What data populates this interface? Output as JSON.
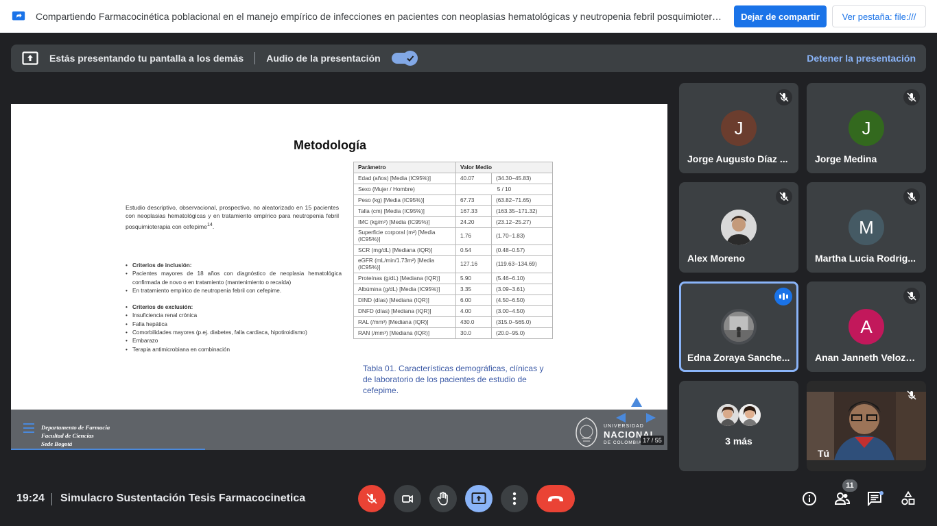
{
  "sharebar": {
    "text": "Compartiendo Farmacocinética poblacional en el manejo empírico de infecciones en pacientes con neoplasias hematológicas y neutropenia febril posquimioterapia con meet....",
    "stop_label": "Dejar de compartir",
    "view_label": "Ver pestaña: file:///"
  },
  "banner": {
    "presenting_text": "Estás presentando tu pantalla a los demás",
    "audio_label": "Audio de la presentación",
    "audio_enabled": true,
    "stop_label": "Detener la presentación"
  },
  "slide": {
    "title": "Metodología",
    "intro": "Estudio descriptivo, observacional, prospectivo, no aleatorizado en 15 pacientes con neoplasias hematológicas y en tratamiento empírico para neutropenia febril posquimioterapia con cefepime",
    "intro_ref": "14",
    "inclusion_head": "Criterios de inclusión:",
    "inclusion": [
      "Pacientes mayores de 18 años con diagnóstico de neoplasia hematológica confirmada de novo o en tratamiento (mantenimiento o recaída)",
      "En tratamiento empírico de neutropenia febril con cefepime."
    ],
    "exclusion_head": "Criterios de exclusión:",
    "exclusion": [
      "Insuficiencia renal crónica",
      "Falla hepática",
      "Comorbilidades mayores (p.ej. diabetes, falla cardiaca, hipotiroidismo)",
      "Embarazo",
      "Terapia antimicrobiana en combinación"
    ],
    "table_headers": [
      "Parámetro",
      "Valor Medio"
    ],
    "table_rows": [
      [
        "Edad (años) [Media (IC95%)]",
        "40.07",
        "(34.30−45.83)"
      ],
      [
        "Sexo (Mujer / Hombre)",
        "5 / 10",
        ""
      ],
      [
        "Peso (kg) [Media (IC95%)]",
        "67.73",
        "(63.82−71.65)"
      ],
      [
        "Talla (cm) [Media (IC95%)]",
        "167.33",
        "(163.35−171.32)"
      ],
      [
        "IMC (kg/m²) [Media (IC95%)]",
        "24.20",
        "(23.12−25.27)"
      ],
      [
        "Superficie corporal (m²) [Media (IC95%)]",
        "1.76",
        "(1.70−1.83)"
      ],
      [
        "SCR (mg/dL) [Mediana (IQR)]",
        "0.54",
        "(0.48−0.57)"
      ],
      [
        "eGFR (mL/min/1.73m²) [Media (IC95%)]",
        "127.16",
        "(119.63−134.69)"
      ],
      [
        "Proteínas (g/dL) [Mediana (IQR)]",
        "5.90",
        "(5.46−6.10)"
      ],
      [
        "Albúmina (g/dL) [Media (IC95%)]",
        "3.35",
        "(3.09−3.61)"
      ],
      [
        "DIND (días) [Mediana (IQR)]",
        "6.00",
        "(4.50−6.50)"
      ],
      [
        "DNFD (días) [Mediana (IQR)]",
        "4.00",
        "(3.00−4.50)"
      ],
      [
        "RAL (/mm³) [Mediana (IQR)]",
        "430.0",
        "(315.0−565.0)"
      ],
      [
        "RAN (/mm³) [Mediana (IQR)]",
        "30.0",
        "(20.0−95.0)"
      ]
    ],
    "caption": "Tabla 01. Características demográficas, clínicas y de laboratorio de los pacientes de estudio de cefepime.",
    "footer_dept": [
      "Departamento de Farmacia",
      "Facultad de Ciencias",
      "Sede Bogotá"
    ],
    "university": [
      "UNIVERSIDAD",
      "NACIONAL",
      "DE COLOMBIA"
    ],
    "page": "17 / 55"
  },
  "participants": [
    {
      "name": "Jorge Augusto Díaz ...",
      "initial": "J",
      "color": "#6b3d2e",
      "muted": true
    },
    {
      "name": "Jorge Medina",
      "initial": "J",
      "color": "#33691e",
      "muted": true
    },
    {
      "name": "Alex Moreno",
      "initial": "",
      "color": "#ffffff",
      "muted": true
    },
    {
      "name": "Martha Lucia Rodrig...",
      "initial": "M",
      "color": "#455a64",
      "muted": true
    },
    {
      "name": "Edna Zoraya Sanche...",
      "initial": "",
      "color": "#5f6368",
      "muted": false,
      "speaking": true
    },
    {
      "name": "Anan Janneth Veloza...",
      "initial": "A",
      "color": "#c2185b",
      "muted": true
    },
    {
      "name": "3 más",
      "initial": "",
      "color": "#3c4043",
      "muted": false
    },
    {
      "name": "Tú",
      "initial": "",
      "color": "#3c4043",
      "muted": true
    }
  ],
  "bottombar": {
    "time": "19:24",
    "meeting_title": "Simulacro Sustentación Tesis Farmacocinetica",
    "people_count": "11"
  },
  "colors": {
    "accent": "#1a73e8",
    "end_call": "#ea4335",
    "active_present": "#8ab4f8"
  }
}
